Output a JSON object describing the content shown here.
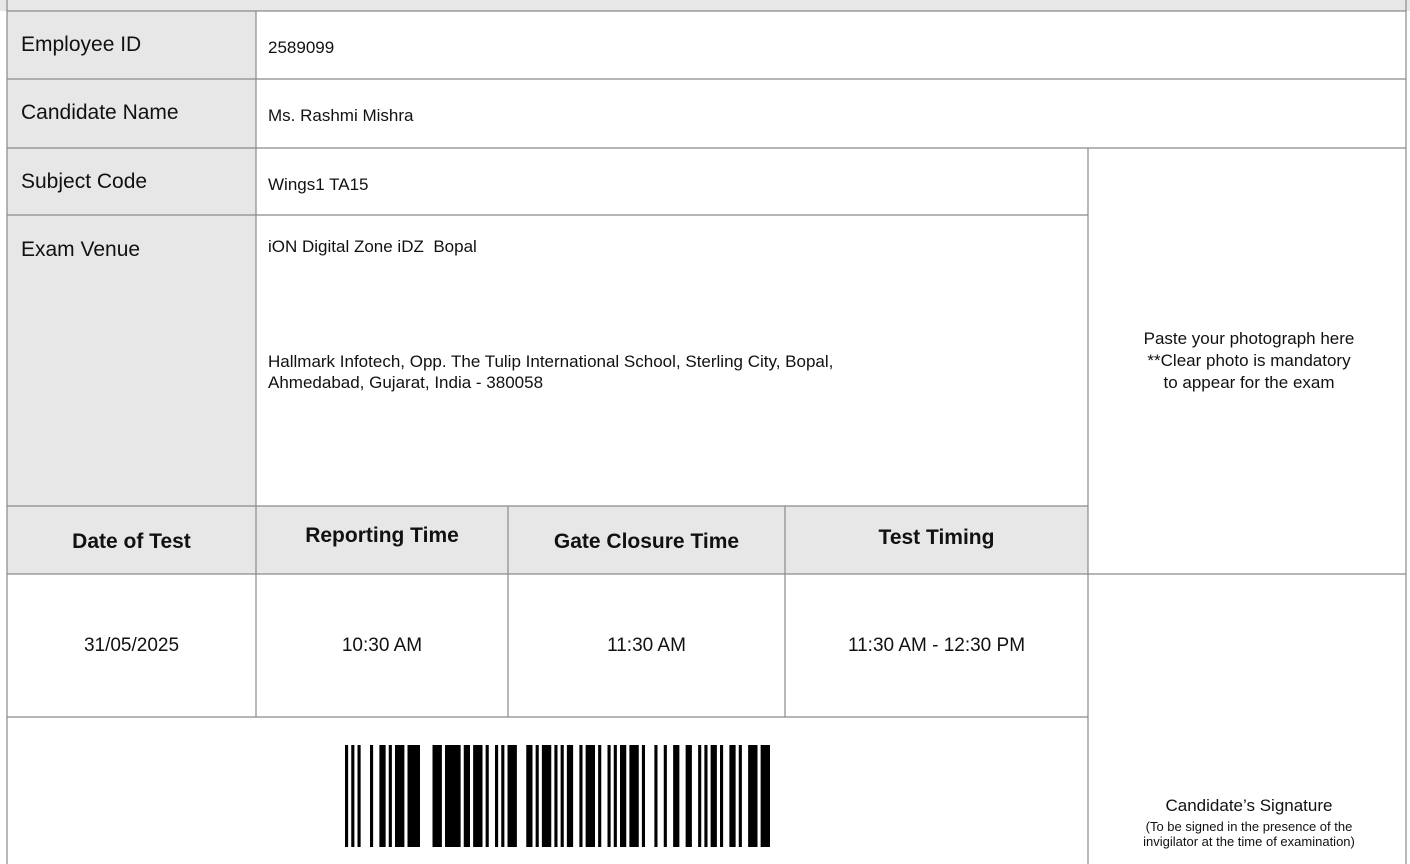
{
  "fields": {
    "employee_id_label": "Employee ID",
    "employee_id_value": "2589099",
    "candidate_name_label": "Candidate Name",
    "candidate_name_value": "Ms. Rashmi Mishra",
    "subject_code_label": "Subject Code",
    "subject_code_value": "Wings1 TA15",
    "exam_venue_label": "Exam Venue",
    "exam_venue_name": "iON Digital Zone iDZ  Bopal",
    "exam_venue_address_line1": "Hallmark Infotech, Opp. The Tulip International School, Sterling City, Bopal,",
    "exam_venue_address_line2": "Ahmedabad, Gujarat, India - 380058"
  },
  "photo_box": {
    "line1": "Paste your photograph here",
    "line2": "**Clear photo is mandatory",
    "line3": "to appear for the exam"
  },
  "schedule": {
    "headers": [
      "Date of Test",
      "Reporting Time",
      "Gate Closure Time",
      "Test Timing"
    ],
    "values": [
      "31/05/2025",
      "10:30 AM",
      "11:30 AM",
      "11:30 AM - 12:30 PM"
    ]
  },
  "signature_box": {
    "title": "Candidate’s Signature",
    "note_line1": "(To be signed in the presence of the",
    "note_line2": "invigilator at the time of examination)"
  },
  "barcode": {
    "pattern": [
      1,
      0,
      1,
      0,
      1,
      0,
      0,
      0,
      1,
      0,
      0,
      1,
      1,
      0,
      1,
      0,
      1,
      1,
      1,
      0,
      1,
      1,
      1,
      1,
      0,
      0,
      0,
      0,
      1,
      1,
      1,
      0,
      1,
      1,
      1,
      1,
      1,
      0,
      1,
      1,
      0,
      1,
      1,
      1,
      0,
      1,
      0,
      0,
      1,
      0,
      1,
      0,
      1,
      1,
      1,
      0,
      0,
      0,
      1,
      1,
      0,
      1,
      0,
      1,
      1,
      1,
      0,
      1,
      0,
      1,
      0,
      1,
      1,
      0,
      0,
      1,
      0,
      1,
      1,
      1,
      0,
      1,
      0,
      0,
      1,
      0,
      1,
      0,
      1,
      1,
      0,
      1,
      1,
      1,
      0,
      1,
      0,
      0,
      0,
      1,
      0,
      0,
      1,
      0,
      0,
      1,
      1,
      0,
      0,
      1,
      1,
      0,
      0,
      1,
      0,
      1,
      0,
      1,
      1,
      0,
      1,
      0,
      0,
      1,
      1,
      0,
      1,
      0,
      0,
      1,
      1,
      1,
      0,
      1,
      1,
      1
    ]
  },
  "colors": {
    "header_gray": "#e7e7e7",
    "border": "#8a8a8a",
    "text": "#111111"
  }
}
